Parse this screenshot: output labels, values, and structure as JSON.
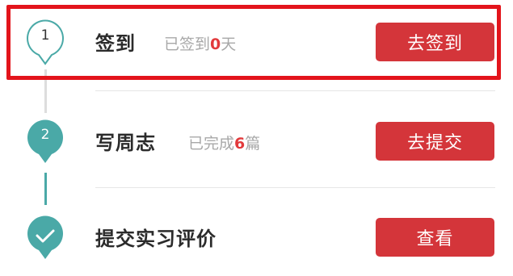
{
  "steps": [
    {
      "marker": "1",
      "title": "签到",
      "status_prefix": "已签到",
      "status_count": "0",
      "status_suffix": "天",
      "button": "去签到",
      "state": "current"
    },
    {
      "marker": "2",
      "title": "写周志",
      "status_prefix": "已完成",
      "status_count": "6",
      "status_suffix": "篇",
      "button": "去提交",
      "state": "done"
    },
    {
      "marker": "check-icon",
      "title": "提交实习评价",
      "button": "查看",
      "state": "done"
    }
  ],
  "colors": {
    "accent_teal": "#4aa9a7",
    "button_red": "#d4353a",
    "count_red": "#e23a3c",
    "highlight_red": "#e3141b"
  }
}
